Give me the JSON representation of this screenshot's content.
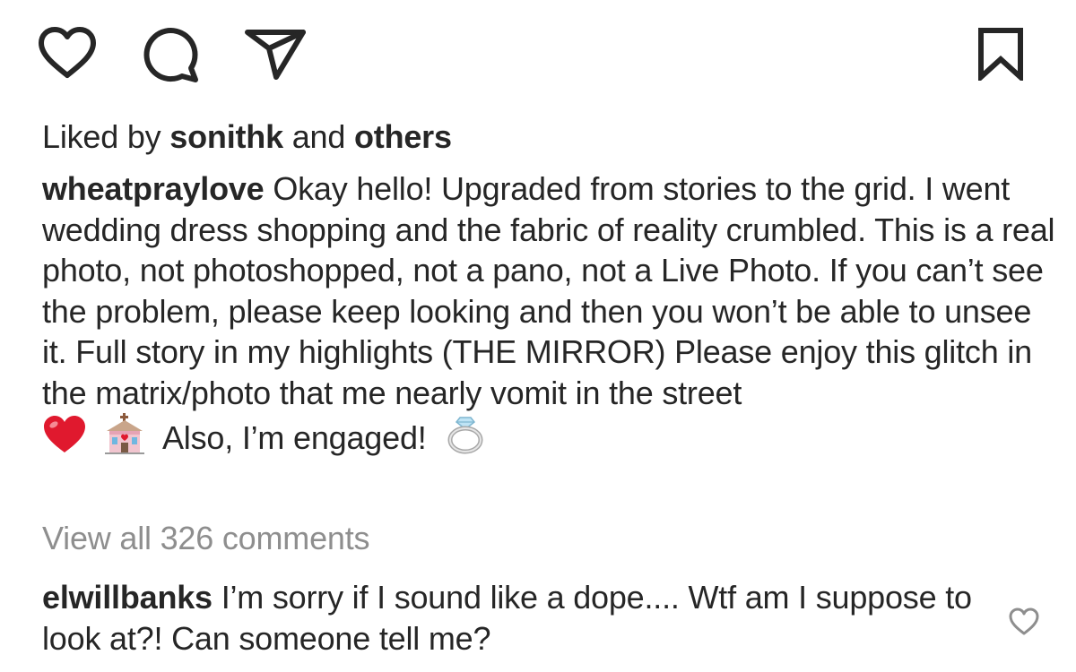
{
  "actions": {
    "icons": [
      "heart-icon",
      "comment-icon",
      "share-icon",
      "bookmark-icon"
    ]
  },
  "likes": {
    "prefix": "Liked by ",
    "user": "sonithk",
    "middle": " and ",
    "others": "others"
  },
  "caption": {
    "username": "wheatpraylove",
    "text": " Okay hello! Upgraded from stories to the grid. I went wedding dress shopping and the fabric of reality crumbled. This is a real photo, not photoshopped, not a pano, not a Live Photo. If you can’t see the problem, please keep looking and then you won’t be able to unsee it. Full story in my highlights (THE MIRROR) Please enjoy this glitch in the matrix/photo that me nearly vomit in the street",
    "tail_text": "Also, I’m engaged!",
    "emojis": [
      "red-heart-emoji",
      "wedding-chapel-emoji",
      "ring-emoji"
    ]
  },
  "view_all": "View all 326 comments",
  "comment": {
    "username": "elwillbanks",
    "text": " I’m sorry if I sound like a dope.... Wtf am I suppose to look at?! Can someone tell me?"
  },
  "colors": {
    "text": "#262626",
    "muted": "#8e8e8e",
    "heart_emoji": "#e0192e"
  }
}
